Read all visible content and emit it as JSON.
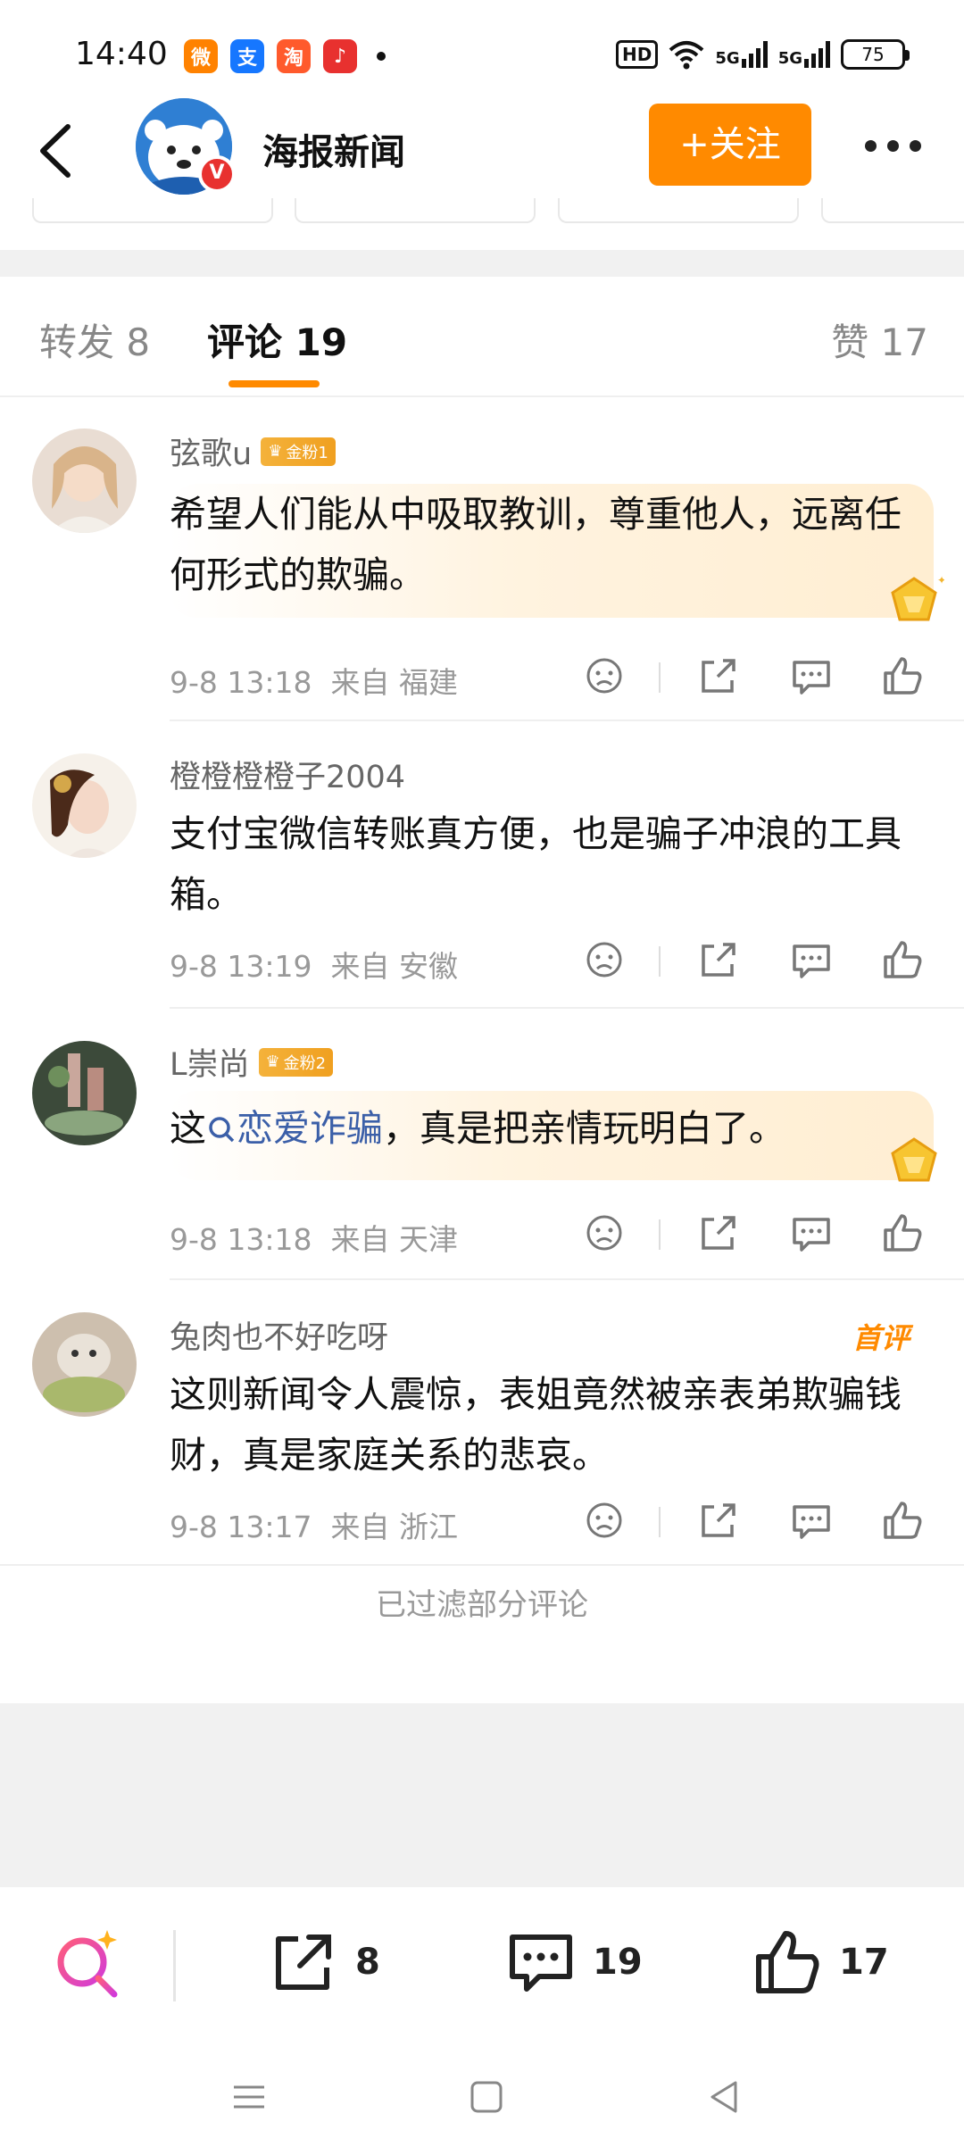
{
  "status_bar": {
    "time": "14:40",
    "app_icons": [
      {
        "name": "weibo-icon",
        "glyph": "微",
        "color": "#ff8200"
      },
      {
        "name": "alipay-icon",
        "glyph": "支",
        "color": "#1677ff"
      },
      {
        "name": "taobao-icon",
        "glyph": "淘",
        "color": "#ff5a2c"
      },
      {
        "name": "music-icon",
        "glyph": "♪",
        "color": "#e8312f"
      }
    ],
    "hd_label": "HD",
    "network_labels": [
      "5G",
      "5G"
    ],
    "battery": "75"
  },
  "header": {
    "account_name": "海报新闻",
    "verified_mark": "V",
    "follow_label": "+关注"
  },
  "tabs": {
    "repost": "转发 8",
    "comments": "评论 19",
    "likes": "赞 17"
  },
  "comments": [
    {
      "user": "弦歌u",
      "badge": "金粉1",
      "text": "希望人们能从中吸取教训，尊重他人，远离任何形式的欺骗。",
      "time": "9-8 13:18",
      "location": "来自 福建"
    },
    {
      "user": "橙橙橙橙子2004",
      "badge": "",
      "text": "支付宝微信转账真方便，也是骗子冲浪的工具箱。",
      "time": "9-8 13:19",
      "location": "来自 安徽"
    },
    {
      "user": "L崇尚",
      "badge": "金粉2",
      "text_before": "这",
      "topic": "恋爱诈骗",
      "text_after": "，真是把亲情玩明白了。",
      "time": "9-8 13:18",
      "location": "来自 天津"
    },
    {
      "user": "兔肉也不好吃呀",
      "badge": "",
      "first_tag": "首评",
      "text": "这则新闻令人震惊，表姐竟然被亲表弟欺骗钱财，真是家庭关系的悲哀。",
      "time": "9-8 13:17",
      "location": "来自 浙江"
    }
  ],
  "filtered_notice": "已过滤部分评论",
  "bottom_bar": {
    "repost_count": "8",
    "comment_count": "19",
    "like_count": "17"
  },
  "colors": {
    "accent": "#ff8a00",
    "topic_link": "#3b5fa8",
    "verified": "#e8312f"
  }
}
